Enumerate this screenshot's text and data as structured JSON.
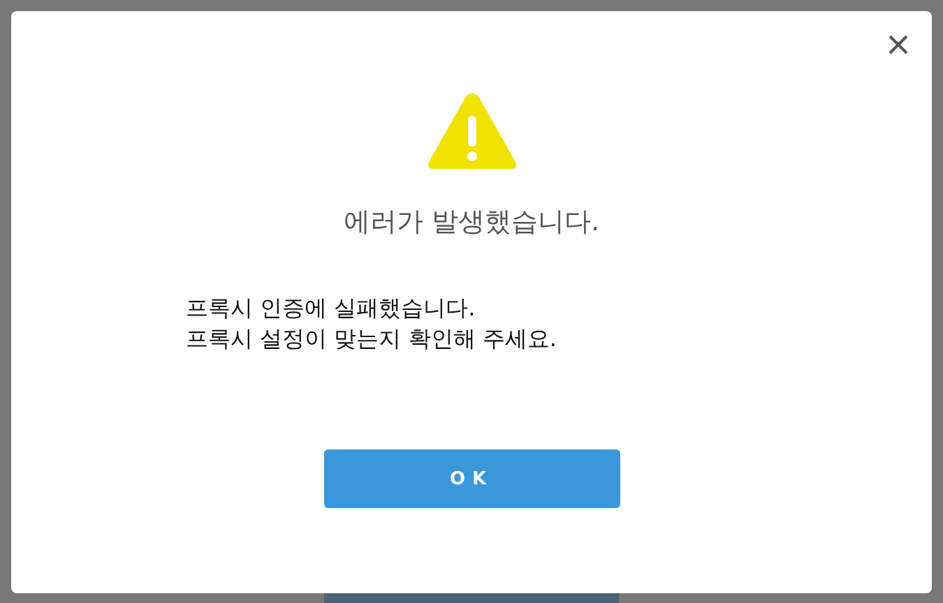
{
  "dialog": {
    "title": "에러가 발생했습니다.",
    "message_lines": [
      "프록시 인증에 실패했습니다.",
      "프록시 설정이 맞는지 확인해 주세요."
    ],
    "buttons": [
      "OK"
    ]
  }
}
